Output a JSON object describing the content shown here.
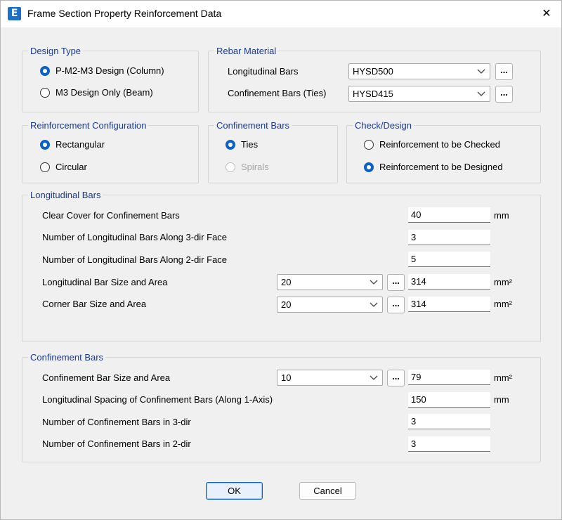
{
  "window": {
    "title": "Frame Section Property Reinforcement Data",
    "app_icon": "E",
    "close_glyph": "✕"
  },
  "design_type": {
    "label": "Design Type",
    "options": [
      {
        "label": "P-M2-M3 Design  (Column)",
        "checked": true
      },
      {
        "label": "M3 Design Only  (Beam)",
        "checked": false
      }
    ]
  },
  "rebar_material": {
    "label": "Rebar Material",
    "longitudinal_label": "Longitudinal Bars",
    "longitudinal_value": "HYSD500",
    "confinement_label": "Confinement Bars (Ties)",
    "confinement_value": "HYSD415",
    "dots": "..."
  },
  "reinforcement_configuration": {
    "label": "Reinforcement Configuration",
    "options": [
      {
        "label": "Rectangular",
        "checked": true
      },
      {
        "label": "Circular",
        "checked": false
      }
    ]
  },
  "confinement_type": {
    "label": "Confinement Bars",
    "options": [
      {
        "label": "Ties",
        "checked": true
      },
      {
        "label": "Spirals",
        "checked": false,
        "disabled": true
      }
    ]
  },
  "check_design": {
    "label": "Check/Design",
    "options": [
      {
        "label": "Reinforcement to be Checked",
        "checked": false
      },
      {
        "label": "Reinforcement to be Designed",
        "checked": true
      }
    ]
  },
  "longitudinal_bars": {
    "label": "Longitudinal Bars",
    "clear_cover_label": "Clear Cover for Confinement Bars",
    "clear_cover_value": "40",
    "clear_cover_unit": "mm",
    "num_3dir_label": "Number of Longitudinal Bars Along 3-dir Face",
    "num_3dir_value": "3",
    "num_2dir_label": "Number of Longitudinal Bars Along 2-dir Face",
    "num_2dir_value": "5",
    "bar_size_label": "Longitudinal Bar Size and Area",
    "bar_size_value": "20",
    "bar_area_value": "314",
    "bar_area_unit": "mm²",
    "corner_label": "Corner Bar Size and Area",
    "corner_size_value": "20",
    "corner_area_value": "314",
    "corner_area_unit": "mm²",
    "dots": "..."
  },
  "confinement_bars": {
    "label": "Confinement Bars",
    "size_label": "Confinement Bar Size and Area",
    "size_value": "10",
    "area_value": "79",
    "area_unit": "mm²",
    "spacing_label": "Longitudinal Spacing of Confinement Bars  (Along 1-Axis)",
    "spacing_value": "150",
    "spacing_unit": "mm",
    "num_3dir_label": "Number of Confinement Bars in 3-dir",
    "num_3dir_value": "3",
    "num_2dir_label": "Number of Confinement Bars in 2-dir",
    "num_2dir_value": "3",
    "dots": "..."
  },
  "buttons": {
    "ok": "OK",
    "cancel": "Cancel"
  },
  "colors": {
    "accent": "#0a62c9",
    "group_label": "#1a3a8c",
    "window_bg": "#f0f0f0"
  }
}
